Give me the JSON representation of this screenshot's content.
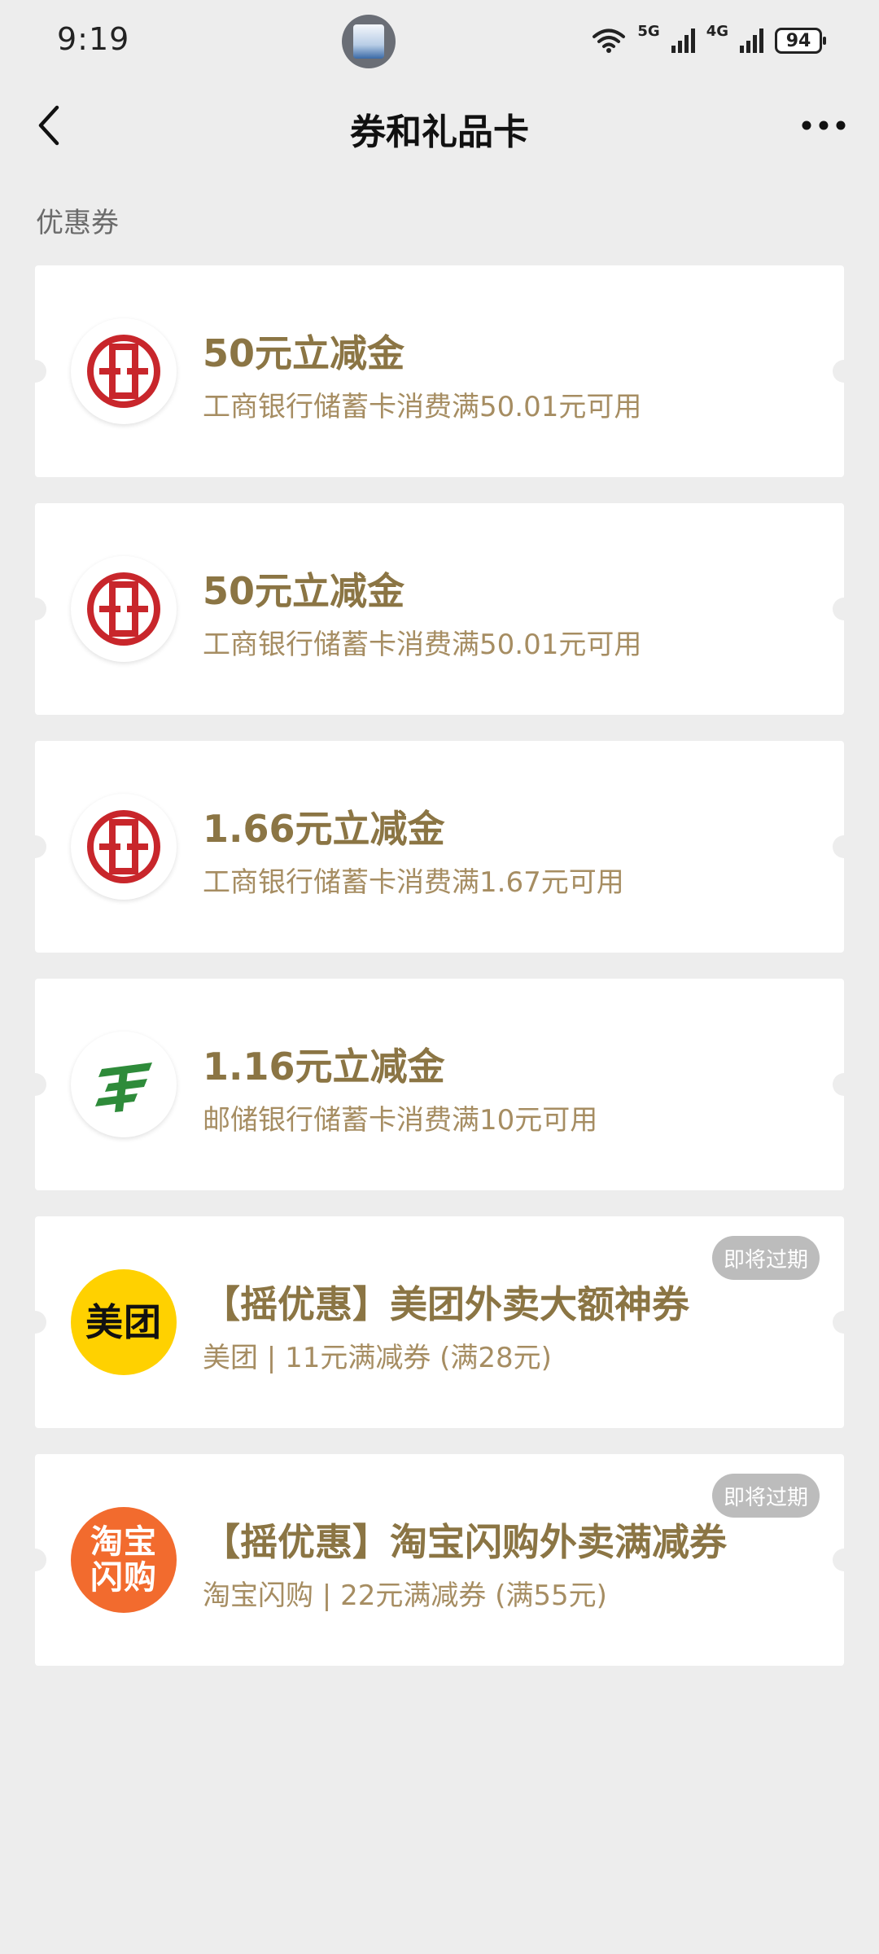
{
  "status_bar": {
    "time": "9:19",
    "network_1": "5G",
    "network_2": "4G",
    "battery": "94"
  },
  "header": {
    "title": "券和礼品卡",
    "back_icon": "chevron-left-icon",
    "more_icon": "more-horizontal-icon"
  },
  "section_label": "优惠券",
  "colors": {
    "title_gold": "#8b7544",
    "desc_gold": "#a68d62",
    "icbc_red": "#c8262b",
    "psbc_green": "#2e8b3a",
    "meituan_yellow": "#ffd100",
    "taobao_orange": "#f26b2e"
  },
  "coupons": [
    {
      "logo": "icbc-logo-icon",
      "title": "50元立减金",
      "desc": "工商银行储蓄卡消费满50.01元可用"
    },
    {
      "logo": "icbc-logo-icon",
      "title": "50元立减金",
      "desc": "工商银行储蓄卡消费满50.01元可用"
    },
    {
      "logo": "icbc-logo-icon",
      "title": "1.66元立减金",
      "desc": "工商银行储蓄卡消费满1.67元可用"
    },
    {
      "logo": "psbc-logo-icon",
      "title": "1.16元立减金",
      "desc": "邮储银行储蓄卡消费满10元可用"
    },
    {
      "logo": "meituan-logo-icon",
      "logo_text": "美团",
      "title": "【摇优惠】美团外卖大额神券",
      "desc": "美团 | 11元满减券 (满28元)",
      "badge": "即将过期"
    },
    {
      "logo": "taobao-flash-logo-icon",
      "logo_text_line1": "淘宝",
      "logo_text_line2": "闪购",
      "title": "【摇优惠】淘宝闪购外卖满减券",
      "desc": "淘宝闪购 | 22元满减券 (满55元)",
      "badge": "即将过期"
    }
  ]
}
